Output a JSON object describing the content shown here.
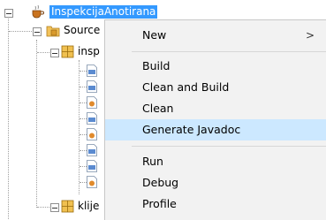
{
  "tree": {
    "project_label": "InspekcijaAnotirana",
    "source_label": "Source",
    "package1_label": "insp",
    "package2_label": "klije"
  },
  "context_menu": {
    "items": [
      {
        "label": "New",
        "has_submenu": true,
        "submenu_arrow": ">"
      },
      {
        "label": "Build"
      },
      {
        "label": "Clean and Build"
      },
      {
        "label": "Clean"
      },
      {
        "label": "Generate Javadoc",
        "highlighted": true
      },
      {
        "label": "Run"
      },
      {
        "label": "Debug"
      },
      {
        "label": "Profile"
      }
    ]
  },
  "colors": {
    "selection": "#3399ff",
    "menu_background": "#f2f2f2",
    "menu_highlight": "#cce8ff"
  }
}
